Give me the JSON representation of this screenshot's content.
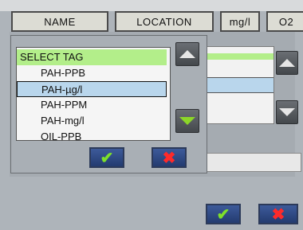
{
  "header": {
    "name_label": "NAME",
    "location_label": "LOCATION",
    "unit_label": "mg/l",
    "o2_label": "O2"
  },
  "tag_list": {
    "items": [
      {
        "label": "SELECT TAG",
        "kind": "header"
      },
      {
        "label": "PAH-PPB",
        "kind": "option"
      },
      {
        "label": "PAH-µg/l",
        "kind": "option",
        "selected": true
      },
      {
        "label": "PAH-PPM",
        "kind": "option"
      },
      {
        "label": "PAH-mg/l",
        "kind": "option"
      },
      {
        "label": "OIL-PPB",
        "kind": "option"
      }
    ]
  },
  "popup": {
    "ok_symbol": "✔",
    "cancel_symbol": "✖"
  },
  "footer": {
    "ok_symbol": "✔",
    "cancel_symbol": "✖"
  },
  "colors": {
    "list_header": "#b3ee8a",
    "selected_row": "#b9d6ec",
    "ok_green": "#7ee02a",
    "cancel_red": "#ff2a2a",
    "button_blue": "#233b70"
  },
  "icons": {
    "scroll_up": "scroll-up-icon",
    "scroll_down": "scroll-down-icon",
    "confirm": "checkmark-icon",
    "cancel": "x-icon"
  }
}
